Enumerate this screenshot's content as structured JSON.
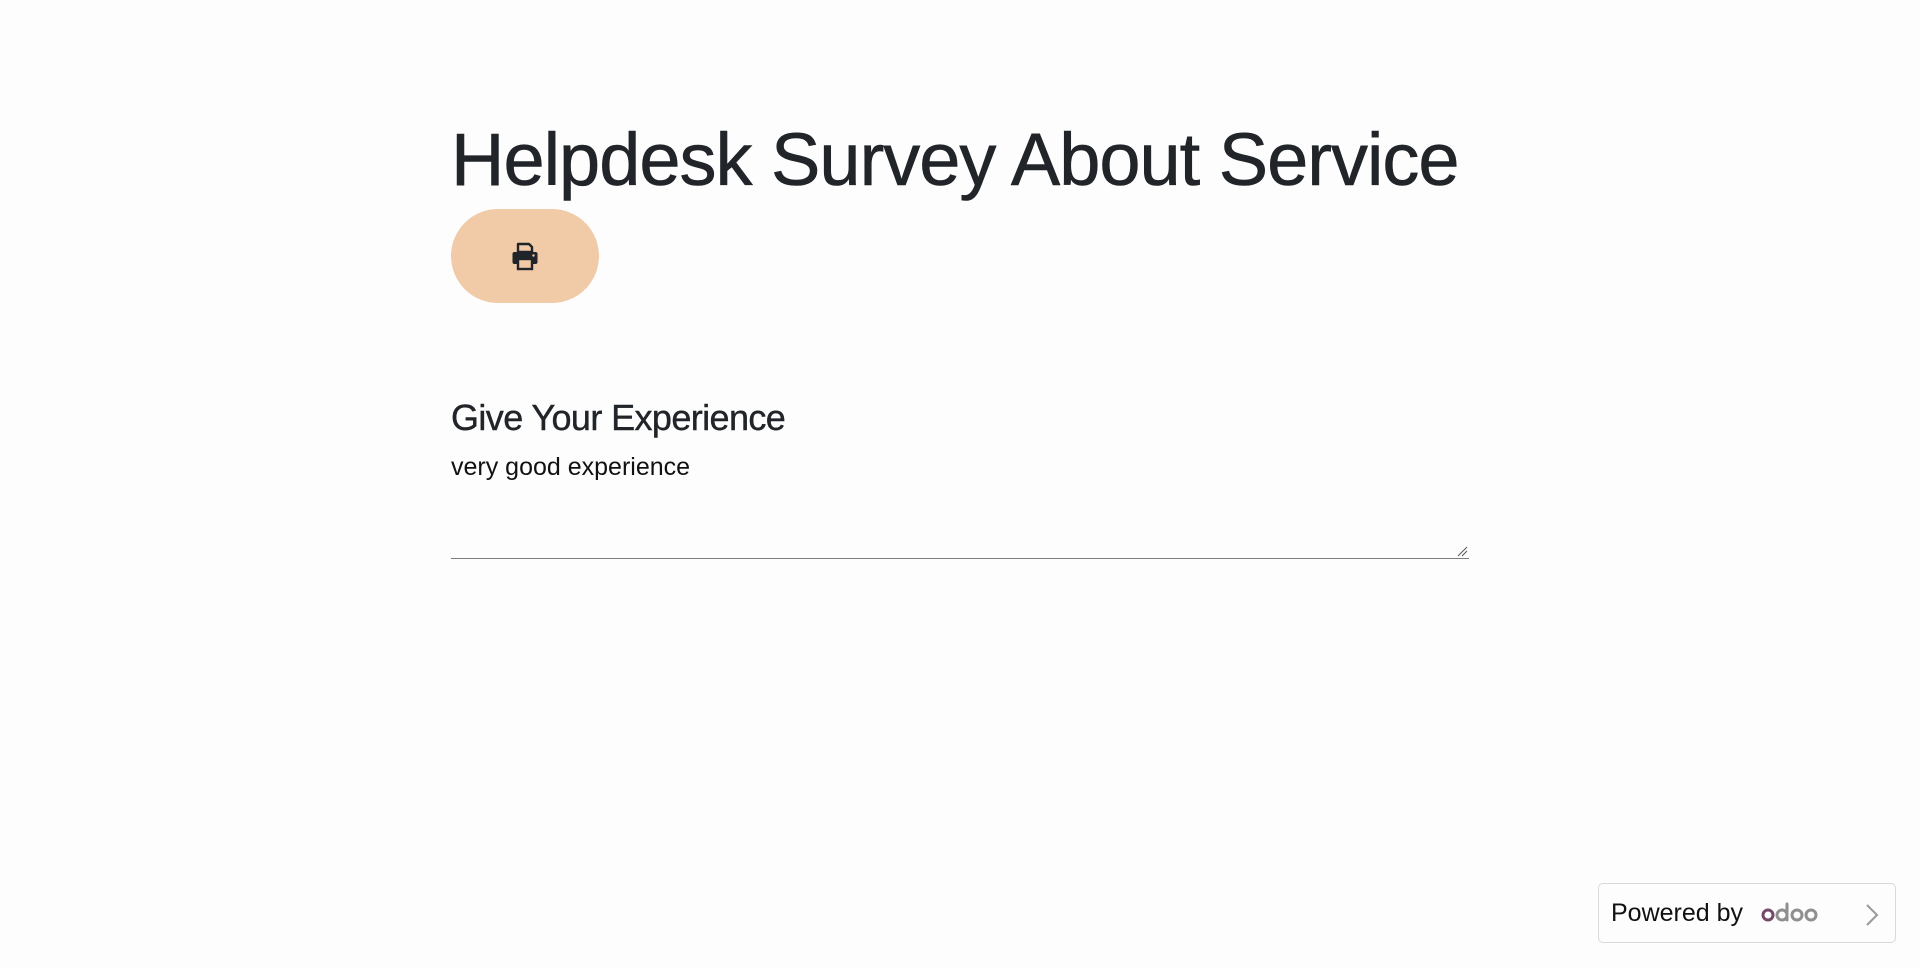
{
  "survey": {
    "title": "Helpdesk Survey About Service"
  },
  "toolbar": {
    "print_icon": "printer-icon",
    "accent_color": "#f1caa7"
  },
  "question": {
    "title": "Give Your Experience",
    "answer_value": "very good experience"
  },
  "footer": {
    "powered_by_label": "Powered by",
    "brand_logo": "odoo",
    "chevron_icon": "chevron-right-icon"
  }
}
